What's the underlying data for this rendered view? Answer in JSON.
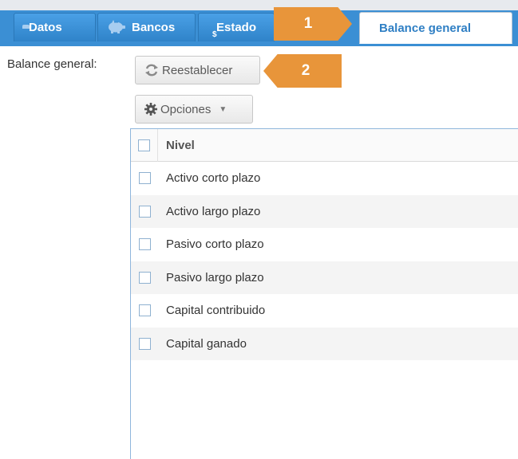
{
  "tabs": [
    {
      "label": "Datos",
      "icon": "folder-icon"
    },
    {
      "label": "Bancos",
      "icon": "piggy-bank-icon"
    },
    {
      "label": "Estado",
      "icon": "document-dollar-icon"
    },
    {
      "label": "Balance general",
      "icon": "document-dollar-icon",
      "active": true
    }
  ],
  "callouts": {
    "first": "1",
    "second": "2"
  },
  "side_label": "Balance general:",
  "toolbar": {
    "reset_label": "Reestablecer",
    "options_label": "Opciones"
  },
  "grid": {
    "column_header": "Nivel",
    "rows": [
      "Activo corto plazo",
      "Activo largo plazo",
      "Pasivo corto plazo",
      "Pasivo largo plazo",
      "Capital contribuido",
      "Capital ganado"
    ]
  },
  "colors": {
    "tab_blue": "#3b8fd4",
    "active_tab_text": "#2f7fc4",
    "callout_orange": "#e8953a"
  }
}
